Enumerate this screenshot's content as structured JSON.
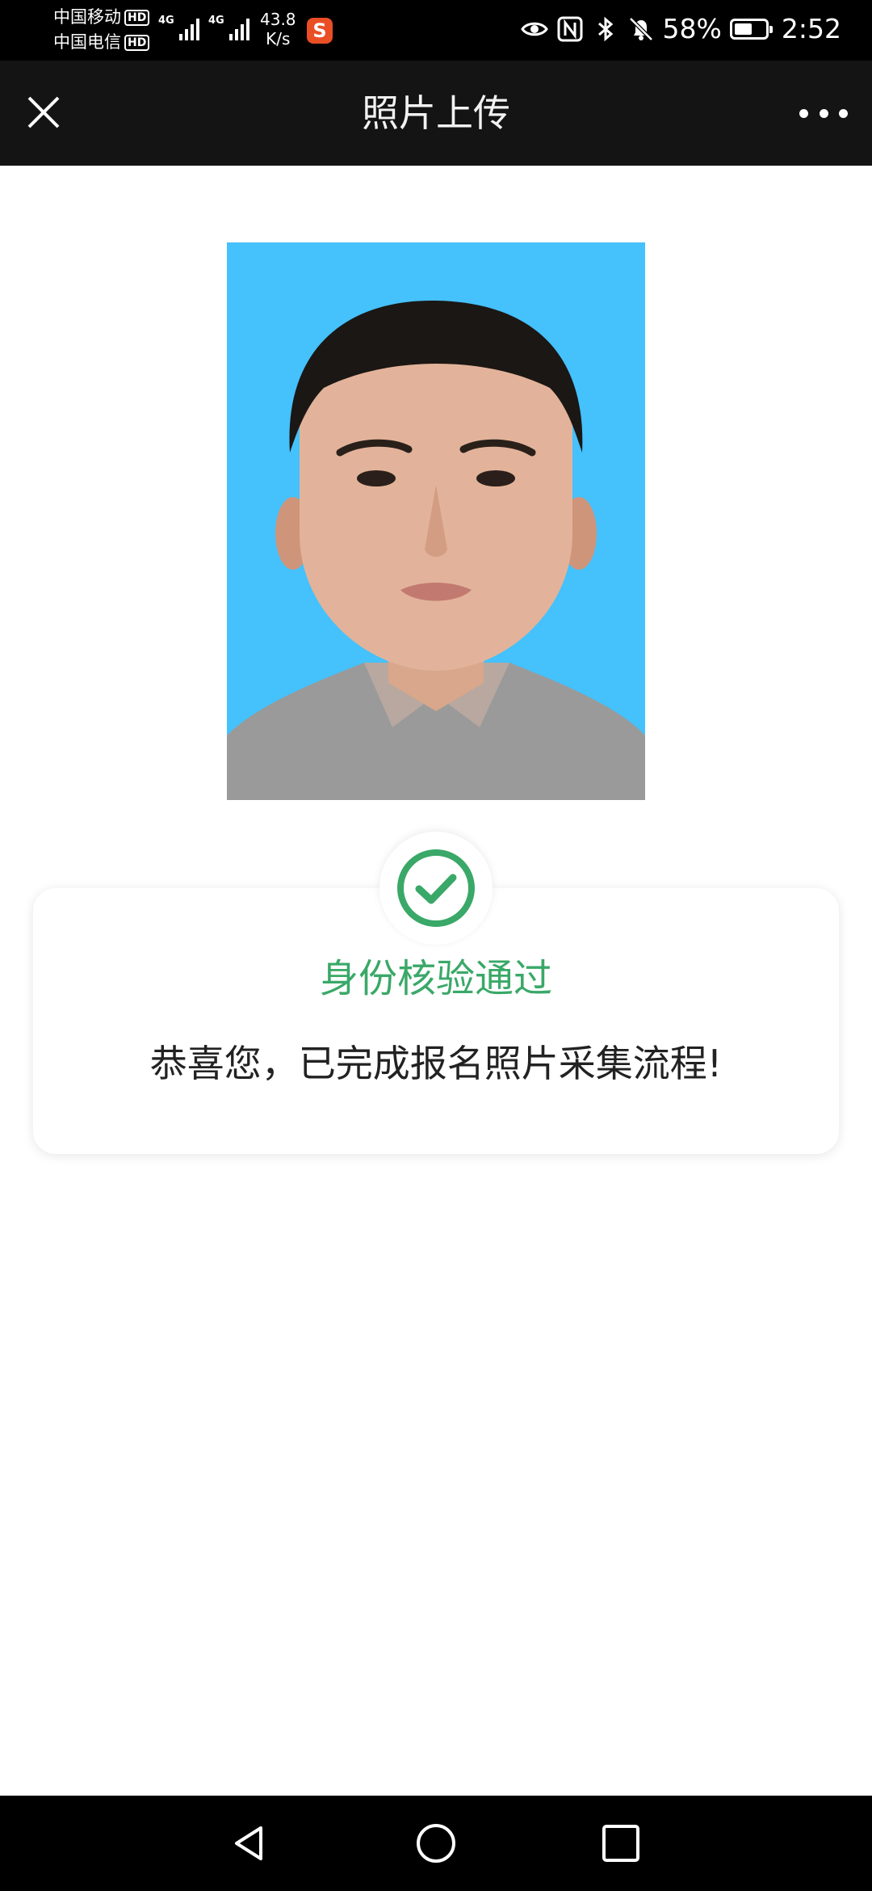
{
  "status_bar": {
    "carrier_1": "中国移动",
    "carrier_2": "中国电信",
    "hd_badge": "HD",
    "network_1": "4G",
    "network_2": "4G",
    "net_speed_value": "43.8",
    "net_speed_unit": "K/s",
    "app_badge": "S",
    "battery_percent": "58%",
    "battery_level": 0.58,
    "time": "2:52",
    "icons": [
      "eye-icon",
      "nfc-icon",
      "bluetooth-icon",
      "bell-off-icon",
      "battery-icon"
    ]
  },
  "header": {
    "title": "照片上传",
    "close_icon": "close-icon",
    "more_icon": "more-dots-icon"
  },
  "photo": {
    "background_color": "#45c1fb"
  },
  "result": {
    "icon": "check-circle-icon",
    "title": "身份核验通过",
    "message": "恭喜您，已完成报名照片采集流程!",
    "accent_color": "#3aa868"
  },
  "nav_bar": {
    "buttons": [
      "back-icon",
      "home-icon",
      "recents-icon"
    ]
  }
}
